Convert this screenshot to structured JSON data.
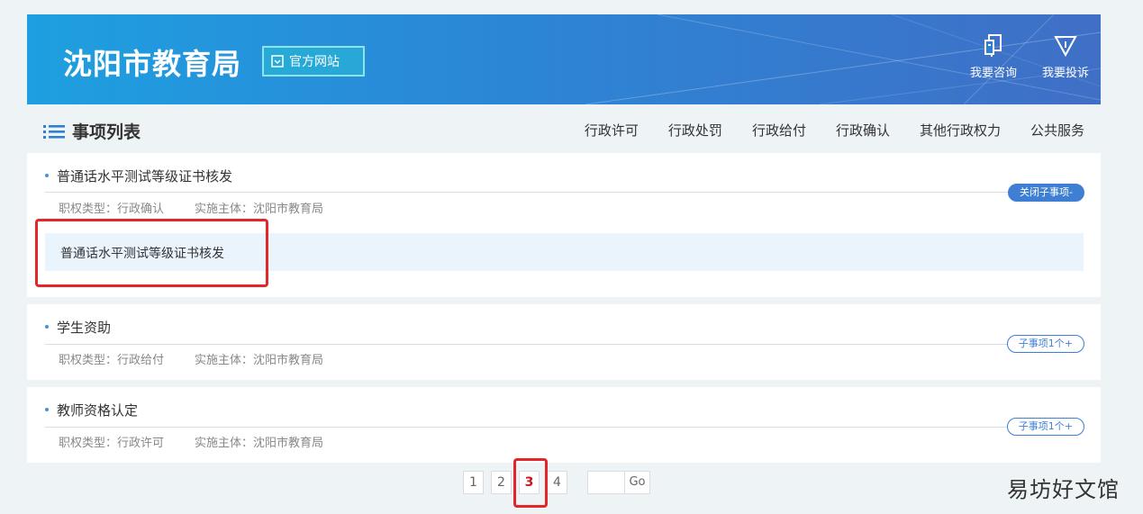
{
  "header": {
    "title": "沈阳市教育局",
    "badge_label": "官方网站",
    "actions": [
      {
        "label": "我要咨询",
        "icon": "consult-icon"
      },
      {
        "label": "我要投诉",
        "icon": "complaint-icon"
      }
    ]
  },
  "list": {
    "title": "事项列表",
    "categories": [
      "行政许可",
      "行政处罚",
      "行政给付",
      "行政确认",
      "其他行政权力",
      "公共服务"
    ]
  },
  "items": [
    {
      "title": "普通话水平测试等级证书核发",
      "meta_type": "职权类型：行政确认",
      "meta_org": "实施主体：沈阳市教育局",
      "toggle_label": "关闭子事项-",
      "sub_items": [
        "普通话水平测试等级证书核发"
      ]
    },
    {
      "title": "学生资助",
      "meta_type": "职权类型：行政给付",
      "meta_org": "实施主体：沈阳市教育局",
      "toggle_label": "子事项1个+"
    },
    {
      "title": "教师资格认定",
      "meta_type": "职权类型：行政许可",
      "meta_org": "实施主体：沈阳市教育局",
      "toggle_label": "子事项1个+"
    }
  ],
  "pagination": {
    "pages": [
      "1",
      "2",
      "3",
      "4"
    ],
    "current": "3",
    "go_label": "Go"
  },
  "watermark": "易坊好文馆",
  "colors": {
    "accent": "#3f7fd3",
    "banner_start": "#1e9fe0",
    "banner_end": "#3f6fc6",
    "highlight": "#e2262a",
    "sub_item_bg": "#eaf4fd"
  }
}
